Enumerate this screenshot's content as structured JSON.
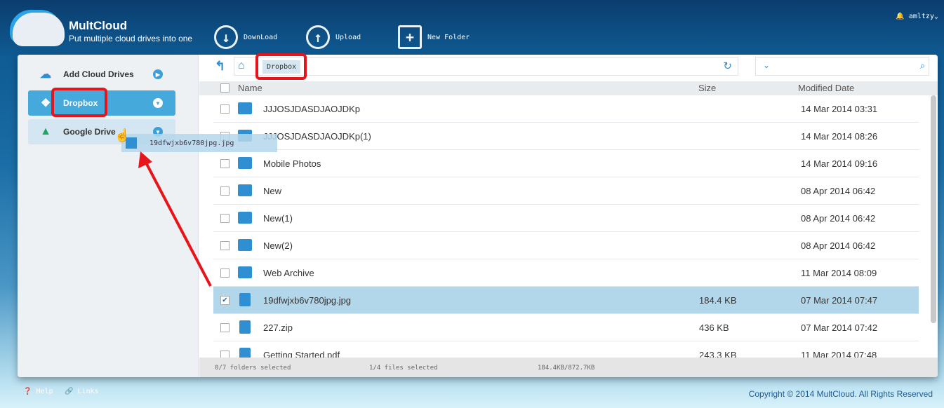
{
  "brand": {
    "name": "MultCloud",
    "tagline": "Put multiple cloud drives into one"
  },
  "toolbar": {
    "download": "DownLoad",
    "upload": "Upload",
    "new_folder": "New Folder"
  },
  "user": {
    "name": "amltzy"
  },
  "sidebar": {
    "items": [
      {
        "label": "Add Cloud Drives"
      },
      {
        "label": "Dropbox"
      },
      {
        "label": "Google Drive"
      }
    ]
  },
  "path": {
    "crumb": "Dropbox"
  },
  "table": {
    "headers": {
      "name": "Name",
      "size": "Size",
      "modified": "Modified Date"
    },
    "rows": [
      {
        "name": "JJJOSJDASDJAOJDKp",
        "size": "",
        "date": "14 Mar 2014 03:31",
        "type": "folder",
        "checked": false
      },
      {
        "name": "JJJOSJDASDJAOJDKp(1)",
        "size": "",
        "date": "14 Mar 2014 08:26",
        "type": "folder",
        "checked": false
      },
      {
        "name": "Mobile Photos",
        "size": "",
        "date": "14 Mar 2014 09:16",
        "type": "folder",
        "checked": false
      },
      {
        "name": "New",
        "size": "",
        "date": "08 Apr 2014 06:42",
        "type": "folder",
        "checked": false
      },
      {
        "name": "New(1)",
        "size": "",
        "date": "08 Apr 2014 06:42",
        "type": "folder",
        "checked": false
      },
      {
        "name": "New(2)",
        "size": "",
        "date": "08 Apr 2014 06:42",
        "type": "folder",
        "checked": false
      },
      {
        "name": "Web Archive",
        "size": "",
        "date": "11 Mar 2014 08:09",
        "type": "folder",
        "checked": false
      },
      {
        "name": "19dfwjxb6v780jpg.jpg",
        "size": "184.4 KB",
        "date": "07 Mar 2014 07:47",
        "type": "image",
        "checked": true
      },
      {
        "name": "227.zip",
        "size": "436 KB",
        "date": "07 Mar 2014 07:42",
        "type": "zip",
        "checked": false
      },
      {
        "name": "Getting Started.pdf",
        "size": "243.3 KB",
        "date": "11 Mar 2014 07:48",
        "type": "pdf",
        "checked": false
      }
    ]
  },
  "status": {
    "folders": "0/7 folders selected",
    "files": "1/4 files selected",
    "size": "184.4KB/872.7KB"
  },
  "drag": {
    "filename": "19dfwjxb6v780jpg.jpg"
  },
  "footer": {
    "help": "Help",
    "links": "Links",
    "copyright": "Copyright © 2014 MultCloud. All Rights Reserved"
  }
}
